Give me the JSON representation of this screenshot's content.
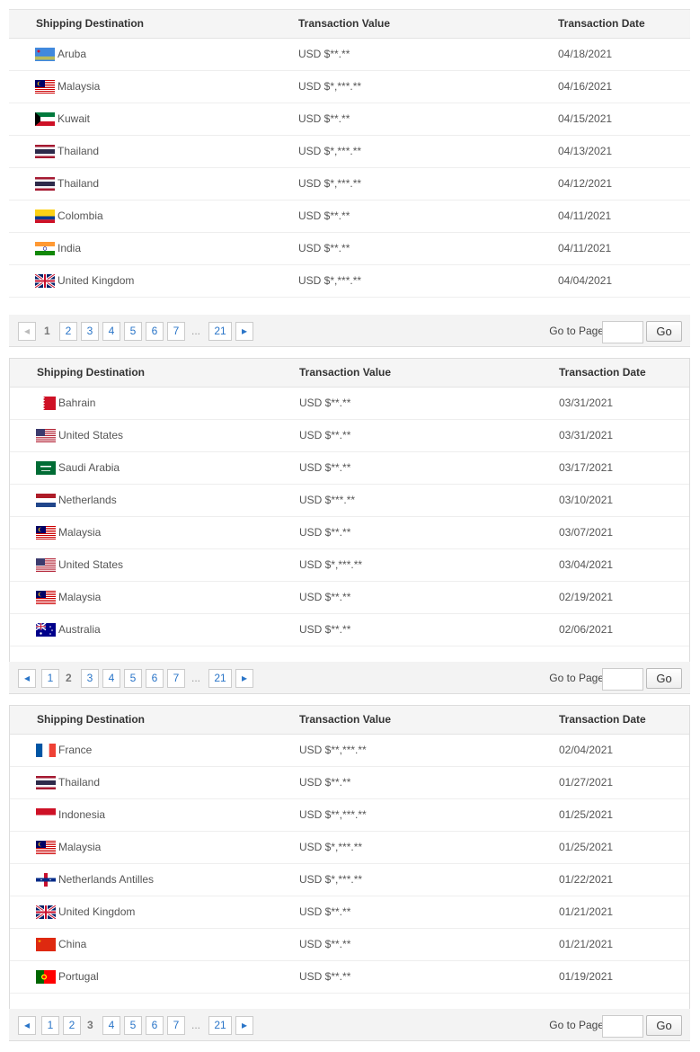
{
  "headers": {
    "destination": "Shipping Destination",
    "value": "Transaction Value",
    "date": "Transaction Date"
  },
  "pager": {
    "pages": [
      "1",
      "2",
      "3",
      "4",
      "5",
      "6",
      "7"
    ],
    "ellipsis": "...",
    "last": "21",
    "goto_label": "Go to Page",
    "go_label": "Go",
    "goto_value": ""
  },
  "sections": [
    {
      "current_page": "1",
      "rows": [
        {
          "country": "Aruba",
          "flag": "aruba-flag",
          "value": "USD $**.**",
          "date": "04/18/2021"
        },
        {
          "country": "Malaysia",
          "flag": "malaysia-flag",
          "value": "USD $*,***.**",
          "date": "04/16/2021"
        },
        {
          "country": "Kuwait",
          "flag": "kuwait-flag",
          "value": "USD $**.**",
          "date": "04/15/2021"
        },
        {
          "country": "Thailand",
          "flag": "thailand-flag",
          "value": "USD $*,***.**",
          "date": "04/13/2021"
        },
        {
          "country": "Thailand",
          "flag": "thailand-flag",
          "value": "USD $*,***.**",
          "date": "04/12/2021"
        },
        {
          "country": "Colombia",
          "flag": "colombia-flag",
          "value": "USD $**.**",
          "date": "04/11/2021"
        },
        {
          "country": "India",
          "flag": "india-flag",
          "value": "USD $**.**",
          "date": "04/11/2021"
        },
        {
          "country": "United Kingdom",
          "flag": "uk-flag",
          "value": "USD $*,***.**",
          "date": "04/04/2021"
        }
      ]
    },
    {
      "current_page": "2",
      "rows": [
        {
          "country": "Bahrain",
          "flag": "bahrain-flag",
          "value": "USD $**.**",
          "date": "03/31/2021"
        },
        {
          "country": "United States",
          "flag": "us-flag",
          "value": "USD $**.**",
          "date": "03/31/2021"
        },
        {
          "country": "Saudi Arabia",
          "flag": "saudi-flag",
          "value": "USD $**.**",
          "date": "03/17/2021"
        },
        {
          "country": "Netherlands",
          "flag": "netherlands-flag",
          "value": "USD $***.**",
          "date": "03/10/2021"
        },
        {
          "country": "Malaysia",
          "flag": "malaysia-flag",
          "value": "USD $**.**",
          "date": "03/07/2021"
        },
        {
          "country": "United States",
          "flag": "us-flag",
          "value": "USD $*,***.**",
          "date": "03/04/2021"
        },
        {
          "country": "Malaysia",
          "flag": "malaysia-flag",
          "value": "USD $**.**",
          "date": "02/19/2021"
        },
        {
          "country": "Australia",
          "flag": "australia-flag",
          "value": "USD $**.**",
          "date": "02/06/2021"
        }
      ]
    },
    {
      "current_page": "3",
      "rows": [
        {
          "country": "France",
          "flag": "france-flag",
          "value": "USD $**,***.**",
          "date": "02/04/2021"
        },
        {
          "country": "Thailand",
          "flag": "thailand-flag",
          "value": "USD $**.**",
          "date": "01/27/2021"
        },
        {
          "country": "Indonesia",
          "flag": "indonesia-flag",
          "value": "USD $**,***.**",
          "date": "01/25/2021"
        },
        {
          "country": "Malaysia",
          "flag": "malaysia-flag",
          "value": "USD $*,***.**",
          "date": "01/25/2021"
        },
        {
          "country": "Netherlands Antilles",
          "flag": "netherlands-antilles-flag",
          "value": "USD $*,***.**",
          "date": "01/22/2021"
        },
        {
          "country": "United Kingdom",
          "flag": "uk-flag",
          "value": "USD $**.**",
          "date": "01/21/2021"
        },
        {
          "country": "China",
          "flag": "china-flag",
          "value": "USD $**.**",
          "date": "01/21/2021"
        },
        {
          "country": "Portugal",
          "flag": "portugal-flag",
          "value": "USD $**.**",
          "date": "01/19/2021"
        }
      ]
    }
  ]
}
